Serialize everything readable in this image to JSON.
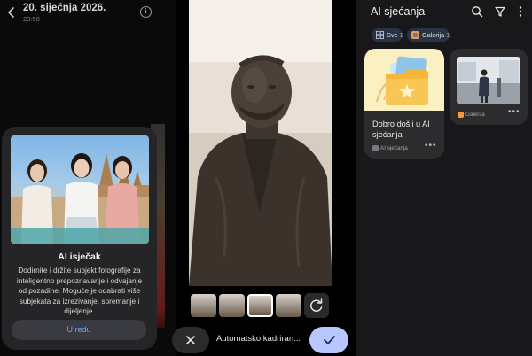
{
  "left_panel": {
    "date": "20. siječnja 2026.",
    "time": "23:50",
    "dialog": {
      "title": "AI isječak",
      "body": "Dodirnite i držite subjekt fotografije za inteligentno prepoznavanje i odvajanje od pozadine. Moguće je odabrati više subjekata za izrezivanje, spremanje i dijeljenje.",
      "ok_label": "U redu"
    }
  },
  "middle_panel": {
    "bottom_label": "Automatsko kadriran...",
    "thumbnail_count": 4,
    "selected_thumbnail": 3
  },
  "right_panel": {
    "title": "AI sjećanja",
    "chips": [
      {
        "label": "Sve",
        "count": "1"
      },
      {
        "label": "Galerija",
        "count": "1"
      }
    ],
    "cards": [
      {
        "title": "Dobro došli u AI sjećanja",
        "source": "AI sjećanja"
      },
      {
        "title": "",
        "source": "Galerija"
      }
    ]
  },
  "colors": {
    "accent_blue": "#6fa3f7",
    "confirm_button": "#b8c8ff",
    "dialog_bg": "#252527",
    "chip_bg": "#2a3344",
    "card_bg": "#2c2c2e"
  },
  "icons": [
    "back-arrow-icon",
    "info-icon",
    "rotate-icon",
    "close-icon",
    "check-icon",
    "search-icon",
    "filter-icon",
    "more-vertical-icon",
    "grid-icon",
    "gallery-icon",
    "folder-photo-icon"
  ]
}
